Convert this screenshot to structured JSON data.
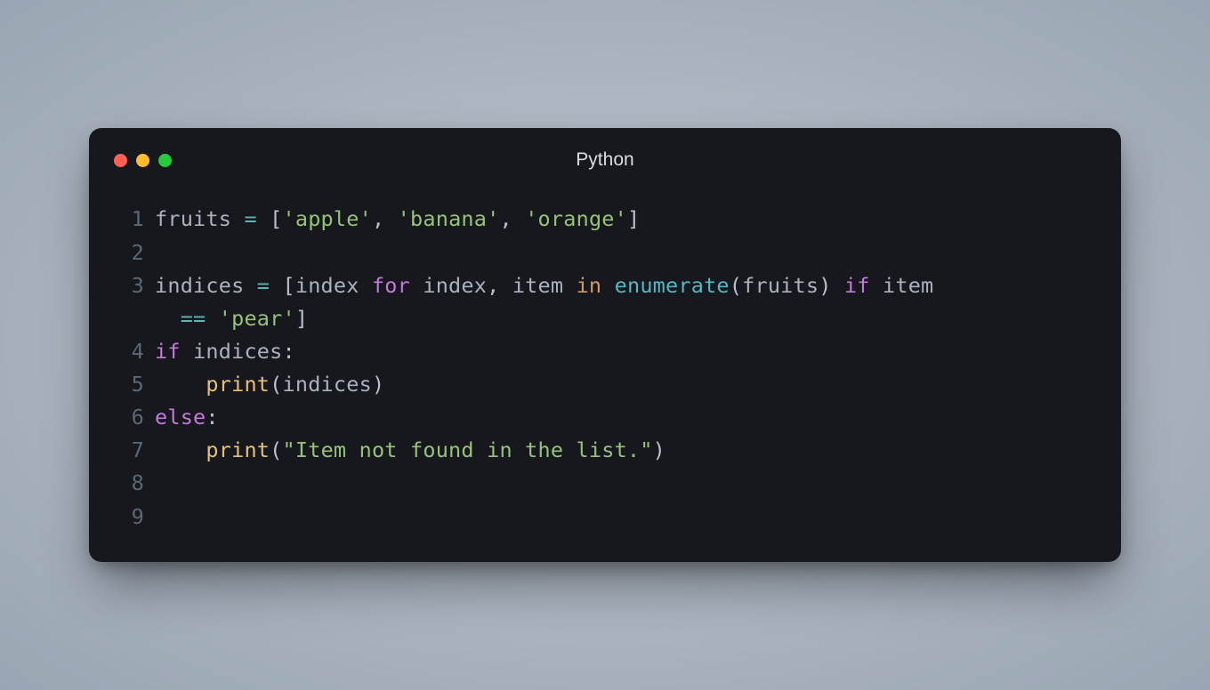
{
  "window": {
    "title": "Python"
  },
  "gutter": {
    "l1": "1",
    "l2": "2",
    "l3": "3",
    "l4": "4",
    "l5": "5",
    "l6": "6",
    "l7": "7",
    "l8": "8",
    "l9": "9"
  },
  "line1": {
    "fruits": "fruits",
    "eq": " = ",
    "lb": "[",
    "q1a": "'",
    "s1": "apple",
    "q1b": "'",
    "c1": ", ",
    "q2a": "'",
    "s2": "banana",
    "q2b": "'",
    "c2": ", ",
    "q3a": "'",
    "s3": "orange",
    "q3b": "'",
    "rb": "]"
  },
  "line3": {
    "indices": "indices",
    "eq": " = ",
    "lb": "[",
    "index1": "index",
    "sp1": " ",
    "for": "for",
    "sp2": " ",
    "index2": "index",
    "comma": ", ",
    "item1": "item",
    "sp3": " ",
    "in": "in",
    "sp4": " ",
    "enumerate": "enumerate",
    "lp": "(",
    "fruits": "fruits",
    "rp": ")",
    "sp5": " ",
    "if": "if",
    "sp6": " ",
    "item2": "item"
  },
  "line3b": {
    "pad": "  ",
    "eq": "== ",
    "q1": "'",
    "s": "pear",
    "q2": "'",
    "rb": "]"
  },
  "line4": {
    "if": "if",
    "sp": " ",
    "indices": "indices",
    "colon": ":"
  },
  "line5": {
    "indent": "    ",
    "print": "print",
    "lp": "(",
    "indices": "indices",
    "rp": ")"
  },
  "line6": {
    "else": "else",
    "colon": ":"
  },
  "line7": {
    "indent": "    ",
    "print": "print",
    "lp": "(",
    "q1": "\"",
    "s": "Item not found in the list.",
    "q2": "\"",
    "rp": ")"
  }
}
